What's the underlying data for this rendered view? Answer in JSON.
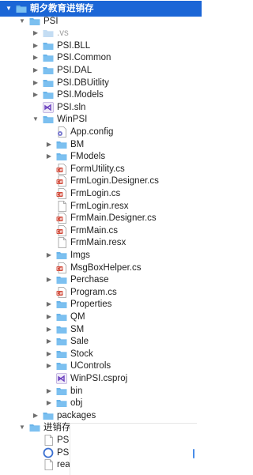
{
  "colors": {
    "accent": "#1b66d6",
    "folder": "#6ab4ea",
    "csharp": "#d24b3b",
    "vs": "#6a3fbf"
  },
  "tree": [
    {
      "label": "朝夕教育进销存",
      "icon": "folder-icon",
      "twisty": "expanded",
      "selected": true
    },
    {
      "label": "PSI",
      "icon": "folder-icon",
      "twisty": "expanded"
    },
    {
      "label": ".vs",
      "icon": "hidden-folder-icon",
      "twisty": "collapsed",
      "dim": true
    },
    {
      "label": "PSI.BLL",
      "icon": "folder-icon",
      "twisty": "collapsed"
    },
    {
      "label": "PSI.Common",
      "icon": "folder-icon",
      "twisty": "collapsed"
    },
    {
      "label": "PSI.DAL",
      "icon": "folder-icon",
      "twisty": "collapsed"
    },
    {
      "label": "PSI.DBUitlity",
      "icon": "folder-icon",
      "twisty": "collapsed"
    },
    {
      "label": "PSI.Models",
      "icon": "folder-icon",
      "twisty": "collapsed"
    },
    {
      "label": "PSI.sln",
      "icon": "vs-solution-icon",
      "twisty": "none"
    },
    {
      "label": "WinPSI",
      "icon": "folder-icon",
      "twisty": "expanded"
    },
    {
      "label": "App.config",
      "icon": "config-file-icon",
      "twisty": "none"
    },
    {
      "label": "BM",
      "icon": "folder-icon",
      "twisty": "collapsed"
    },
    {
      "label": "FModels",
      "icon": "folder-icon",
      "twisty": "collapsed"
    },
    {
      "label": "FormUtility.cs",
      "icon": "csharp-file-icon",
      "twisty": "none"
    },
    {
      "label": "FrmLogin.Designer.cs",
      "icon": "csharp-file-icon",
      "twisty": "none"
    },
    {
      "label": "FrmLogin.cs",
      "icon": "csharp-file-icon",
      "twisty": "none"
    },
    {
      "label": "FrmLogin.resx",
      "icon": "file-icon",
      "twisty": "none"
    },
    {
      "label": "FrmMain.Designer.cs",
      "icon": "csharp-file-icon",
      "twisty": "none"
    },
    {
      "label": "FrmMain.cs",
      "icon": "csharp-file-icon",
      "twisty": "none"
    },
    {
      "label": "FrmMain.resx",
      "icon": "file-icon",
      "twisty": "none"
    },
    {
      "label": "Imgs",
      "icon": "folder-icon",
      "twisty": "collapsed"
    },
    {
      "label": "MsgBoxHelper.cs",
      "icon": "csharp-file-icon",
      "twisty": "none"
    },
    {
      "label": "Perchase",
      "icon": "folder-icon",
      "twisty": "collapsed"
    },
    {
      "label": "Program.cs",
      "icon": "csharp-file-icon",
      "twisty": "none"
    },
    {
      "label": "Properties",
      "icon": "folder-icon",
      "twisty": "collapsed"
    },
    {
      "label": "QM",
      "icon": "folder-icon",
      "twisty": "collapsed"
    },
    {
      "label": "SM",
      "icon": "folder-icon",
      "twisty": "collapsed"
    },
    {
      "label": "Sale",
      "icon": "folder-icon",
      "twisty": "collapsed"
    },
    {
      "label": "Stock",
      "icon": "folder-icon",
      "twisty": "collapsed"
    },
    {
      "label": "UControls",
      "icon": "folder-icon",
      "twisty": "collapsed"
    },
    {
      "label": "WinPSI.csproj",
      "icon": "vs-project-icon",
      "twisty": "none"
    },
    {
      "label": "bin",
      "icon": "folder-icon",
      "twisty": "collapsed"
    },
    {
      "label": "obj",
      "icon": "folder-icon",
      "twisty": "collapsed"
    },
    {
      "label": "packages",
      "icon": "folder-icon",
      "twisty": "collapsed"
    },
    {
      "label": "进销存",
      "icon": "folder-icon",
      "twisty": "expanded"
    },
    {
      "label": "PSI",
      "icon": "file-icon",
      "twisty": "none"
    },
    {
      "label": "PSI",
      "icon": "vs-circle-icon",
      "twisty": "none"
    },
    {
      "label": "rea",
      "icon": "file-icon",
      "twisty": "none"
    }
  ]
}
